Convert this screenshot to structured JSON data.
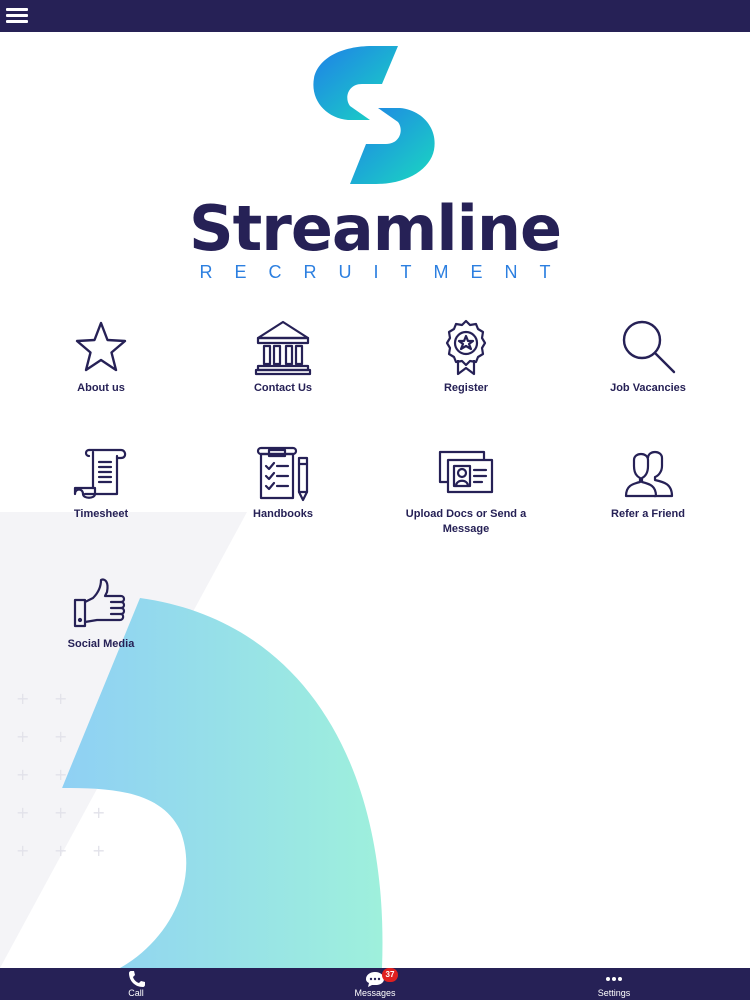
{
  "header": {
    "menu_icon": "hamburger-icon"
  },
  "brand": {
    "name": "Streamline",
    "tagline": "RECRUITMENT"
  },
  "tiles": [
    {
      "label": "About us",
      "icon": "star-icon"
    },
    {
      "label": "Contact Us",
      "icon": "bank-building-icon"
    },
    {
      "label": "Register",
      "icon": "award-ribbon-icon"
    },
    {
      "label": "Job Vacancies",
      "icon": "magnifier-icon"
    },
    {
      "label": "Timesheet",
      "icon": "scroll-document-icon"
    },
    {
      "label": "Handbooks",
      "icon": "clipboard-checklist-icon"
    },
    {
      "label": "Upload Docs or Send a Message",
      "icon": "id-cards-icon"
    },
    {
      "label": "Refer a Friend",
      "icon": "two-people-icon"
    },
    {
      "label": "Social Media",
      "icon": "thumbs-up-icon"
    }
  ],
  "bottom_nav": [
    {
      "label": "Call",
      "icon": "phone-icon"
    },
    {
      "label": "Messages",
      "icon": "chat-bubble-icon",
      "badge": "37"
    },
    {
      "label": "Settings",
      "icon": "more-dots-icon"
    }
  ],
  "colors": {
    "bar": "#262156",
    "brand_text": "#262156",
    "tagline": "#2c7fe0",
    "badge": "#e02020"
  }
}
